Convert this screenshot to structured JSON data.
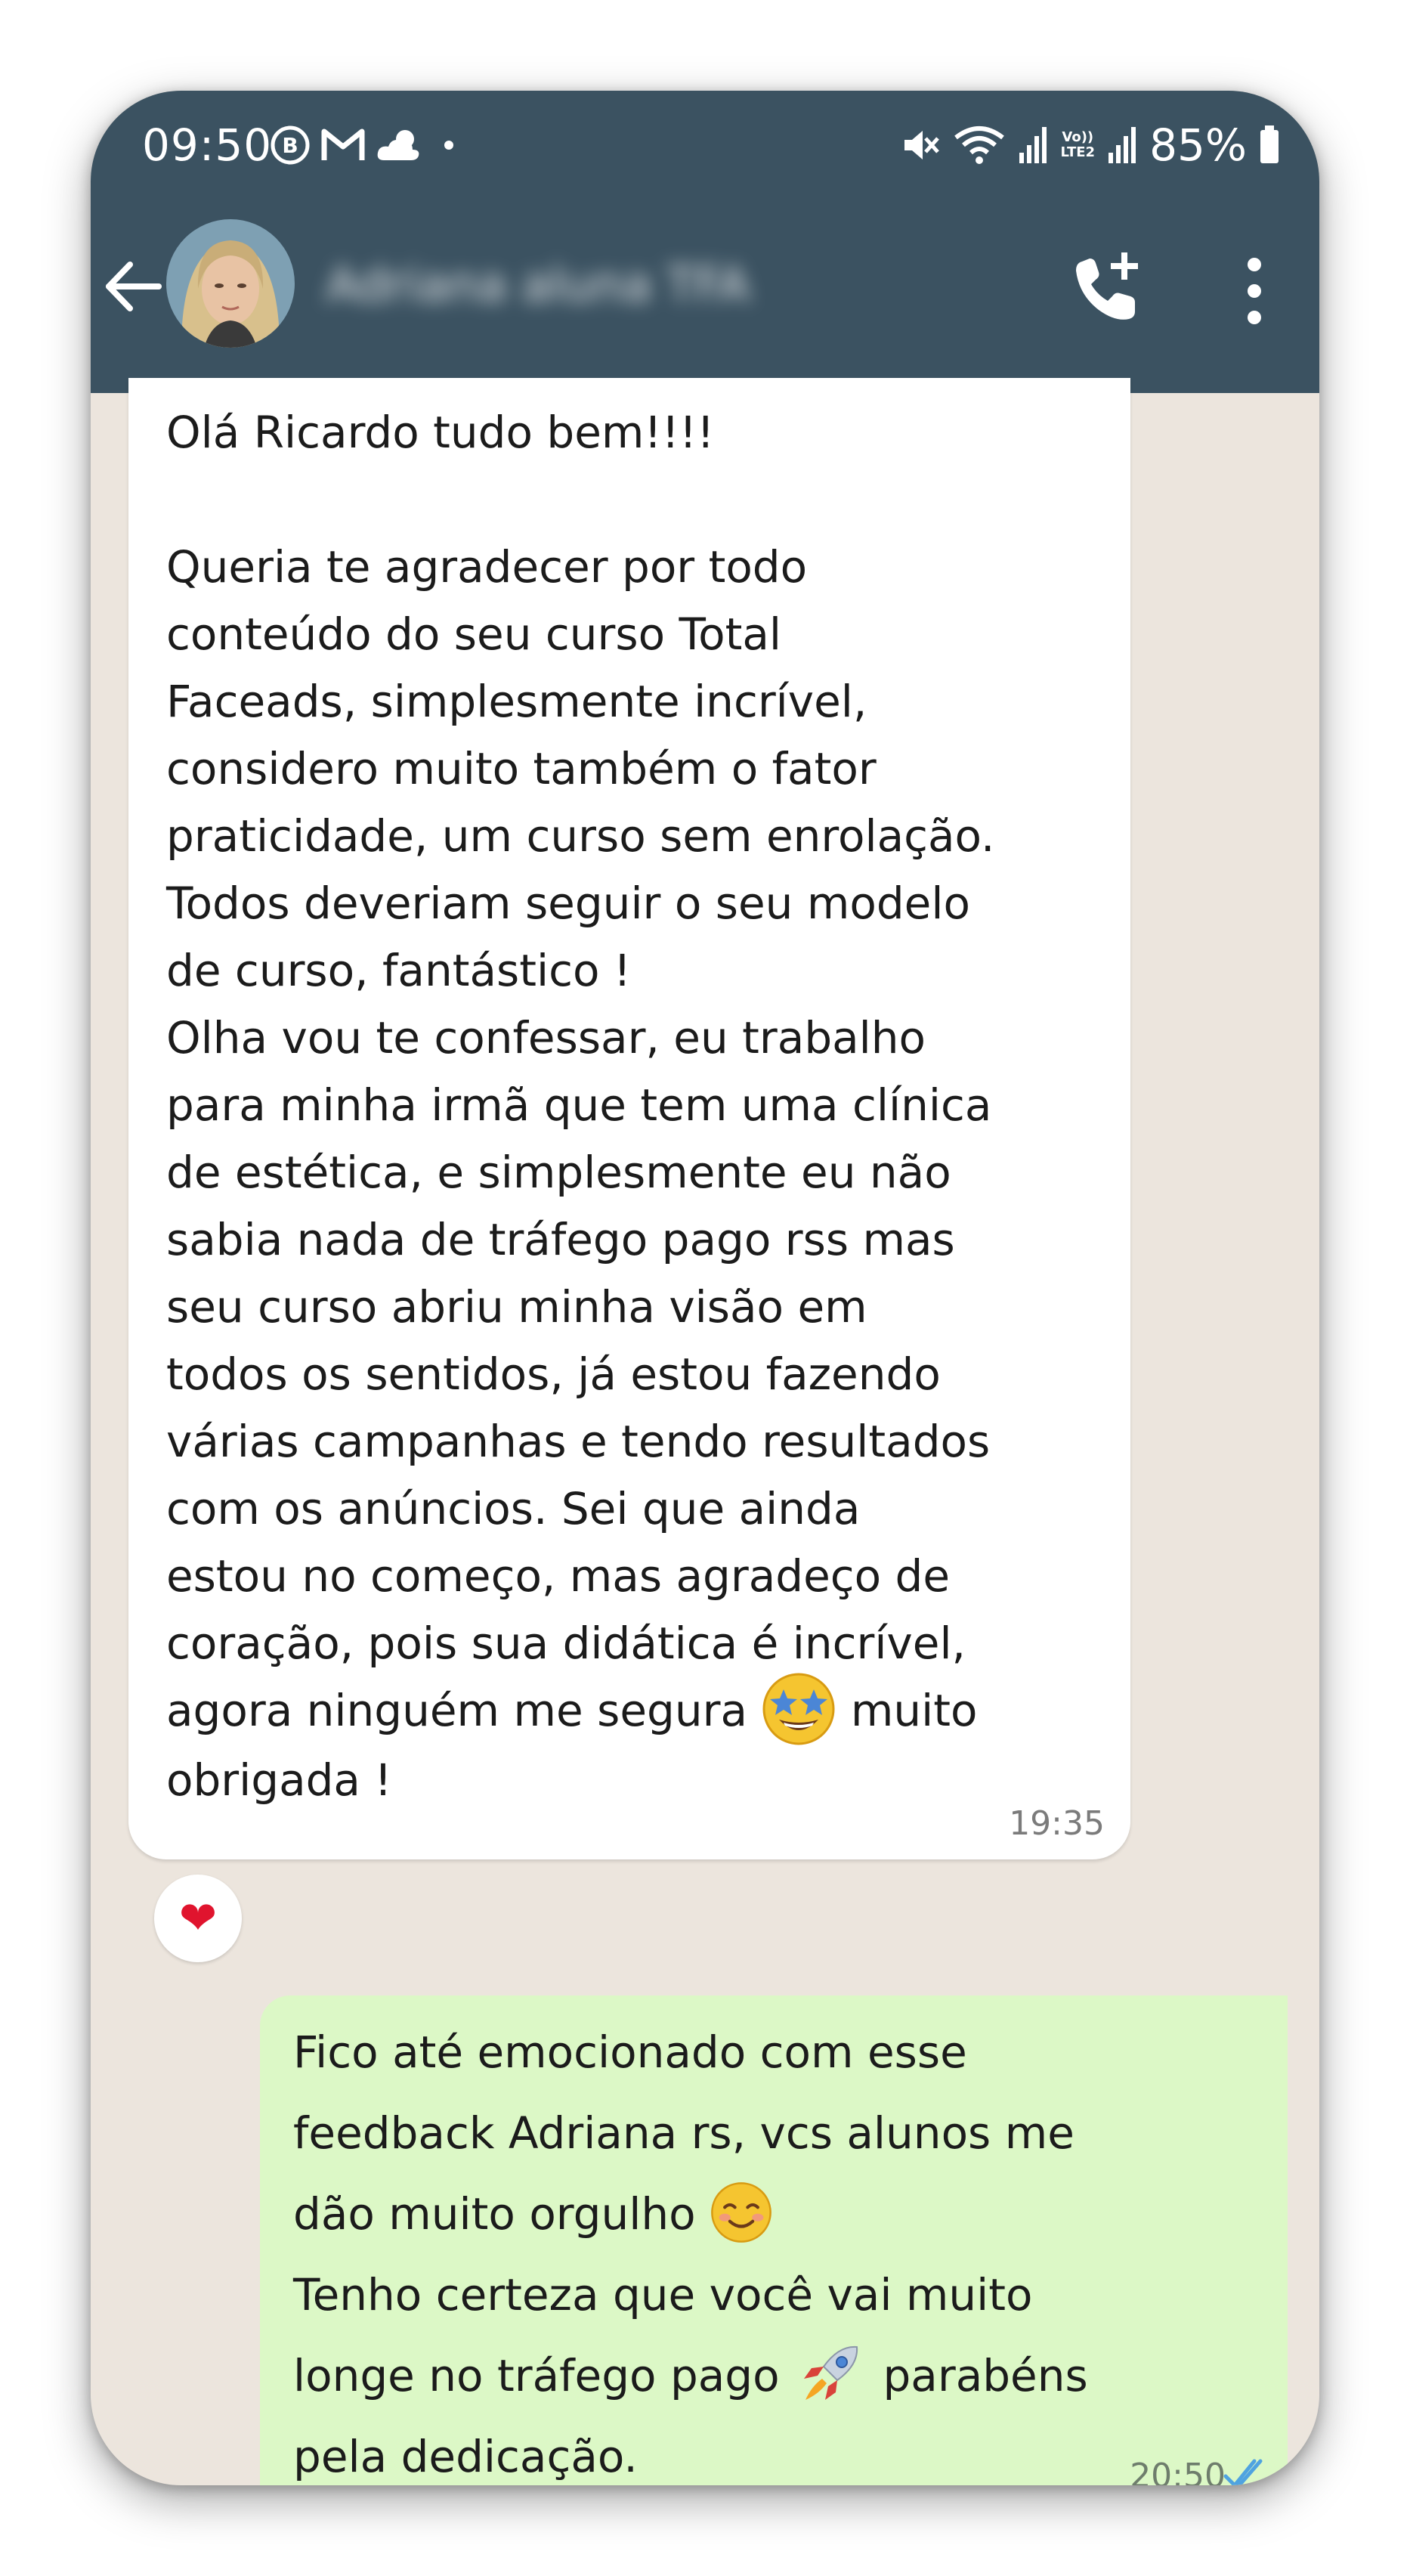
{
  "status_bar": {
    "time": "09:50",
    "battery": "85%",
    "volte_top": "Vo))",
    "volte_bottom": "LTE2"
  },
  "header": {
    "contact_name": "Adriana aluna TFA",
    "icons": {
      "back": "arrow-left-icon",
      "call": "add-call-icon",
      "menu": "more-vert-icon"
    },
    "background_color": "#3b5261"
  },
  "messages": [
    {
      "direction": "incoming",
      "text": "Olá Ricardo tudo bem!!!!\n\nQueria  te agradecer por todo\nconteúdo do seu curso Total\nFaceads, simplesmente incrível,\nconsidero muito também o fator\npraticidade, um curso sem enrolação.\nTodos deveriam seguir o seu modelo\nde curso, fantástico !\nOlha vou te confessar, eu trabalho\npara minha irmã que tem uma clínica\nde estética, e simplesmente eu não\nsabia nada de tráfego pago rss mas\nseu curso abriu minha visão em\ntodos os sentidos, já estou fazendo\nvárias campanhas e tendo resultados\ncom os anúncios. Sei que ainda\nestou no começo, mas agradeço de\ncoração, pois sua didática é incrível,",
      "last_line_before_emoji": "agora ninguém me segura ",
      "last_line_after_emoji": " muito",
      "final_line": "obrigada !",
      "emoji": "star-struck-emoji",
      "time": "19:35",
      "reaction": "❤",
      "bubble_color": "#ffffff"
    },
    {
      "direction": "outgoing",
      "line1": "Fico até emocionado com esse",
      "line2": "feedback Adriana rs, vcs alunos me",
      "line3_before_emoji": "dão muito orgulho ",
      "line4": "Tenho certeza que você vai muito",
      "line5_before_emoji": "longe no tráfego pago ",
      "line5_after_emoji": " parabéns",
      "line6": "pela dedicação.",
      "emojis": [
        "smiling-face-emoji",
        "rocket-emoji"
      ],
      "time": "20:50",
      "status": "read-double-check-icon",
      "bubble_color": "#dcf8c6"
    }
  ]
}
